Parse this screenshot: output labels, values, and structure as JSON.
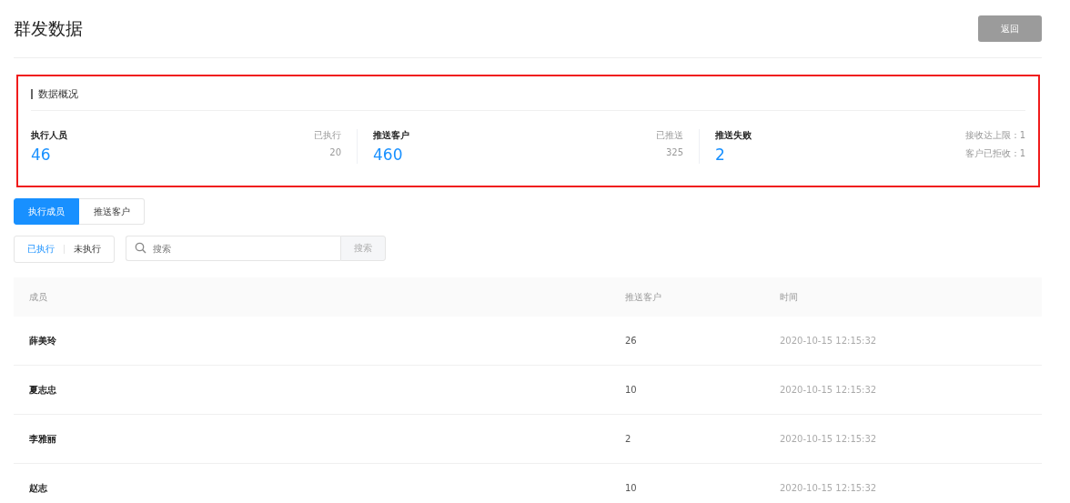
{
  "page": {
    "title": "群发数据",
    "back_button": "返回"
  },
  "overview": {
    "title": "数据概况",
    "highlighted": true,
    "stats": [
      {
        "label": "执行人员",
        "value": "46",
        "details": [
          "已执行",
          "20"
        ]
      },
      {
        "label": "推送客户",
        "value": "460",
        "details": [
          "已推送",
          "325"
        ]
      },
      {
        "label": "推送失败",
        "value": "2",
        "details": [
          "接收达上限：1",
          "客户已拒收：1"
        ]
      }
    ]
  },
  "tabs": [
    {
      "label": "执行成员",
      "selected": true
    },
    {
      "label": "推送客户",
      "selected": false
    }
  ],
  "filters": [
    {
      "label": "已执行",
      "selected": true
    },
    {
      "label": "未执行",
      "selected": false
    }
  ],
  "search": {
    "placeholder": "搜索",
    "button": "搜索"
  },
  "table": {
    "columns": [
      "成员",
      "推送客户",
      "时间"
    ],
    "rows": [
      [
        "薛美玲",
        "26",
        "2020-10-15 12:15:32"
      ],
      [
        "夏志忠",
        "10",
        "2020-10-15 12:15:32"
      ],
      [
        "李雅丽",
        "2",
        "2020-10-15 12:15:32"
      ],
      [
        "赵志",
        "10",
        "2020-10-15 12:15:32"
      ]
    ]
  }
}
